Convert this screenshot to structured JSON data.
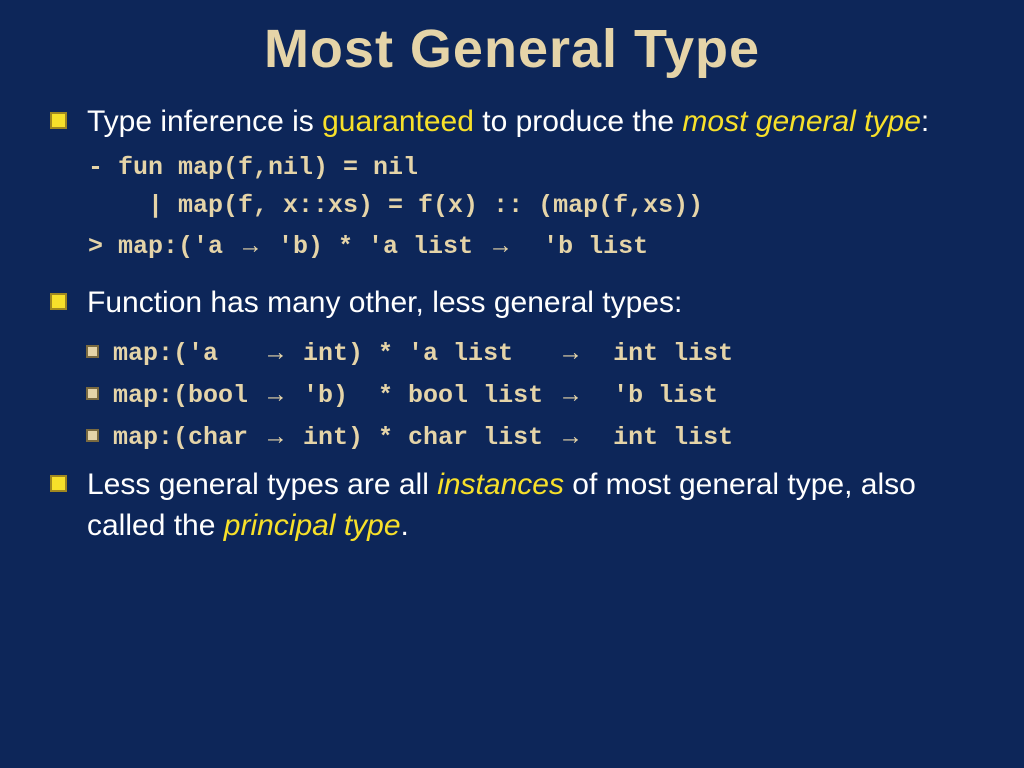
{
  "title": "Most General Type",
  "b1": {
    "pre": "Type inference is ",
    "hl1": "guaranteed",
    "mid": " to produce the ",
    "hl2": "most general type",
    "post": ":"
  },
  "code": {
    "l1": "- fun map(f,nil) = nil",
    "l2": "    | map(f, x::xs) = f(x) :: (map(f,xs))",
    "l3a": "> map:('a ",
    "l3b": " 'b) * 'a list ",
    "l3c": "  'b list"
  },
  "b2": "Function has many other, less general types:",
  "types": {
    "t1a": "map:('a   ",
    "t1b": " int) * 'a list   ",
    "t1c": "  int list",
    "t2a": "map:(bool ",
    "t2b": " 'b)  * bool list ",
    "t2c": "  'b list",
    "t3a": "map:(char ",
    "t3b": " int) * char list ",
    "t3c": "  int list"
  },
  "b3": {
    "pre": "Less general types are all ",
    "hl1": "instances",
    "mid": " of most general type, also called the ",
    "hl2": "principal type",
    "post": "."
  },
  "arrow": "→"
}
